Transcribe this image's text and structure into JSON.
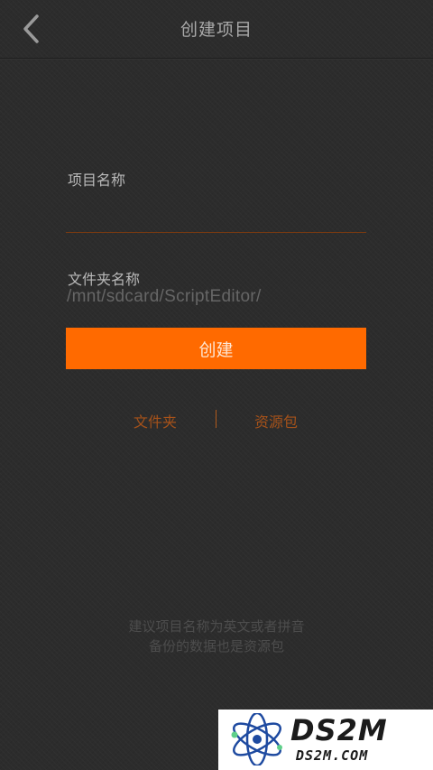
{
  "header": {
    "title": "创建项目",
    "back_icon": "chevron-left-icon"
  },
  "form": {
    "project_name_label": "项目名称",
    "project_name_value": "",
    "folder_label": "文件夹名称",
    "folder_path": "/mnt/sdcard/ScriptEditor/",
    "create_label": "创建"
  },
  "links": {
    "folder": "文件夹",
    "resource_pack": "资源包"
  },
  "hint": {
    "line1": "建议项目名称为英文或者拼音",
    "line2": "备份的数据也是资源包"
  },
  "watermark": {
    "logo_text": "DS2M",
    "sub_text": "DS2M.COM"
  },
  "colors": {
    "accent": "#ff6a00",
    "link": "#a6521a",
    "background": "#2c2c2c"
  }
}
